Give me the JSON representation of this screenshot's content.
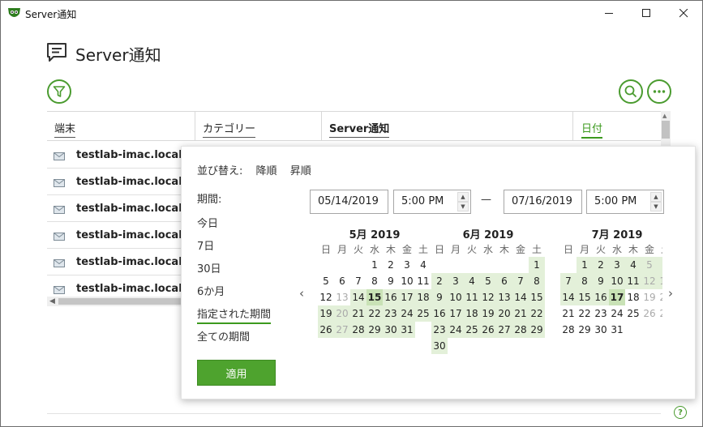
{
  "window": {
    "title": "Server通知"
  },
  "header": {
    "title": "Server通知"
  },
  "table": {
    "columns": [
      "端末",
      "カテゴリー",
      "Server通知",
      "日付"
    ],
    "rows": [
      "testlab-imac.local",
      "testlab-imac.local",
      "testlab-imac.local",
      "testlab-imac.local",
      "testlab-imac.local",
      "testlab-imac.local"
    ]
  },
  "popup": {
    "sort_label": "並び替え:",
    "sort_desc": "降順",
    "sort_asc": "昇順",
    "period_label": "期間:",
    "options": [
      "今日",
      "7日",
      "30日",
      "6か月",
      "指定された期間",
      "全ての期間"
    ],
    "selected_option": "指定された期間",
    "start_date": "05/14/2019",
    "start_time": "5:00 PM",
    "end_date": "07/16/2019",
    "end_time": "5:00 PM",
    "dash": "—",
    "apply_label": "適用",
    "weekdays": [
      "日",
      "月",
      "火",
      "水",
      "木",
      "金",
      "土"
    ],
    "months": [
      {
        "title": "5月 2019",
        "first_weekday": 3,
        "days": 31
      },
      {
        "title": "6月 2019",
        "first_weekday": 6,
        "days": 30
      },
      {
        "title": "7月 2019",
        "first_weekday": 1,
        "days": 31
      }
    ]
  },
  "colors": {
    "accent": "#4ea32e",
    "range_bg": "#e3f0d9"
  },
  "icons": [
    "app-logo-icon",
    "chat-icon",
    "filter-icon",
    "search-icon",
    "more-icon",
    "mail-icon",
    "help-icon"
  ]
}
